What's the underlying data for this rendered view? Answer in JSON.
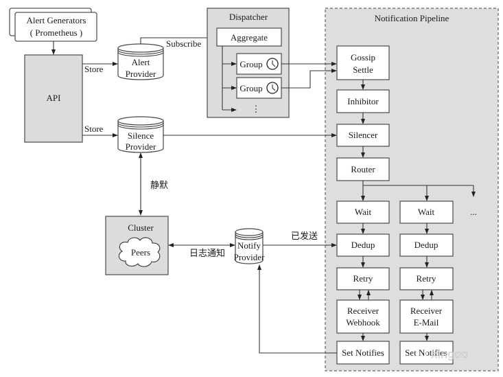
{
  "alert_generators": {
    "line1": "Alert Generators",
    "line2": "( Prometheus )"
  },
  "api": {
    "label": "API"
  },
  "store_label_1": "Store",
  "store_label_2": "Store",
  "alert_provider": {
    "line1": "Alert",
    "line2": "Provider"
  },
  "silence_provider": {
    "line1": "Silence",
    "line2": "Provider"
  },
  "notify_provider": {
    "line1": "Notify",
    "line2": "Provider"
  },
  "subscribe_label": "Subscribe",
  "dispatcher": {
    "title": "Dispatcher",
    "aggregate": "Aggregate",
    "group1": "Group",
    "group2": "Group",
    "more": "⋮"
  },
  "pipeline": {
    "title": "Notification Pipeline",
    "gossip": {
      "line1": "Gossip",
      "line2": "Settle"
    },
    "inhibitor": "Inhibitor",
    "silencer": "Silencer",
    "router": "Router",
    "more": "...",
    "columns": [
      {
        "wait": "Wait",
        "dedup": "Dedup",
        "retry": "Retry",
        "receiver1": "Receiver",
        "receiver2": "Webhook",
        "set_notifies": "Set Notifies"
      },
      {
        "wait": "Wait",
        "dedup": "Dedup",
        "retry": "Retry",
        "receiver1": "Receiver",
        "receiver2": "E-Mail",
        "set_notifies": "Set Notifies"
      }
    ]
  },
  "silence_label": "静默",
  "cluster": {
    "title": "Cluster",
    "peers": "Peers"
  },
  "log_notify_label": "日志通知",
  "sent_label": "已发送",
  "watermark": "xingoo"
}
